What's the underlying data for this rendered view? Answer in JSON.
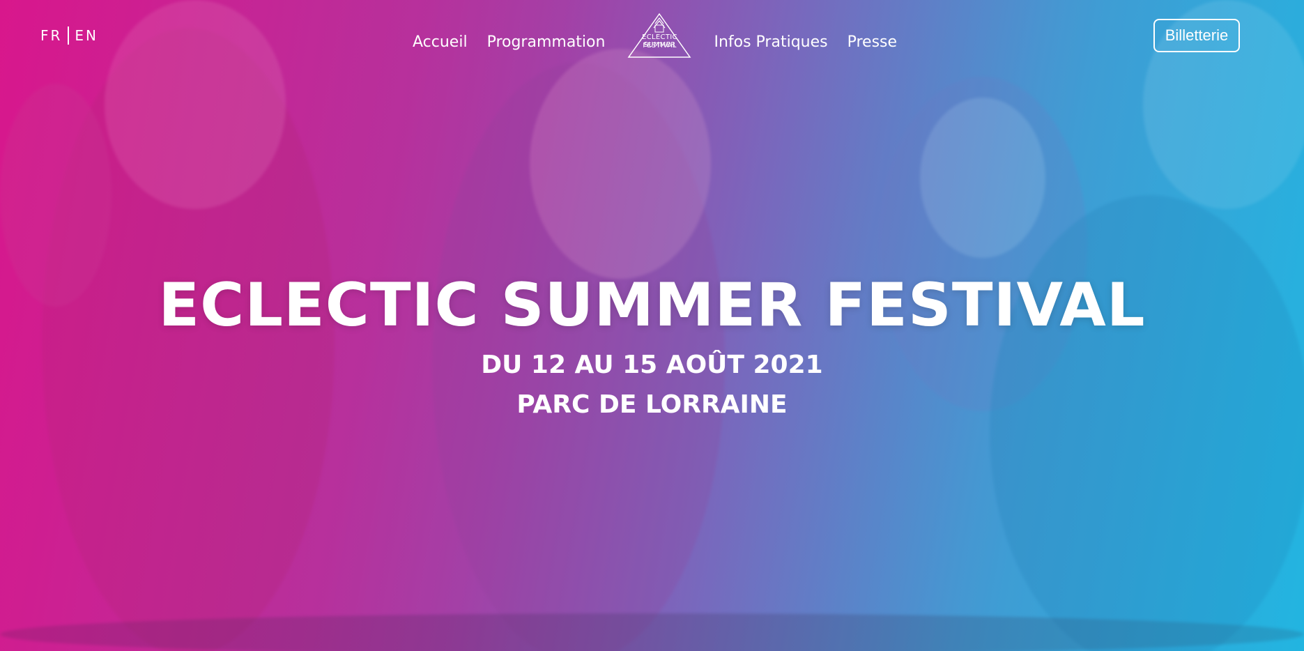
{
  "nav": {
    "lang_fr": "FR",
    "lang_en": "EN",
    "items": [
      "Accueil",
      "Programmation",
      "Infos Pratiques",
      "Presse"
    ],
    "logo_line1": "ECLECTIC SUMMER",
    "logo_line2": "FESTIVAL",
    "cta": "Billetterie"
  },
  "hero": {
    "title": "ECLECTIC SUMMER FESTIVAL",
    "dates": "DU 12 AU 15 AOÛT 2021",
    "place": "PARC DE LORRAINE",
    "background_image": "festival-crowd-photo"
  },
  "colors": {
    "gradient_left": "#d41a8c",
    "gradient_right": "#27b6e0",
    "text": "#ffffff"
  }
}
